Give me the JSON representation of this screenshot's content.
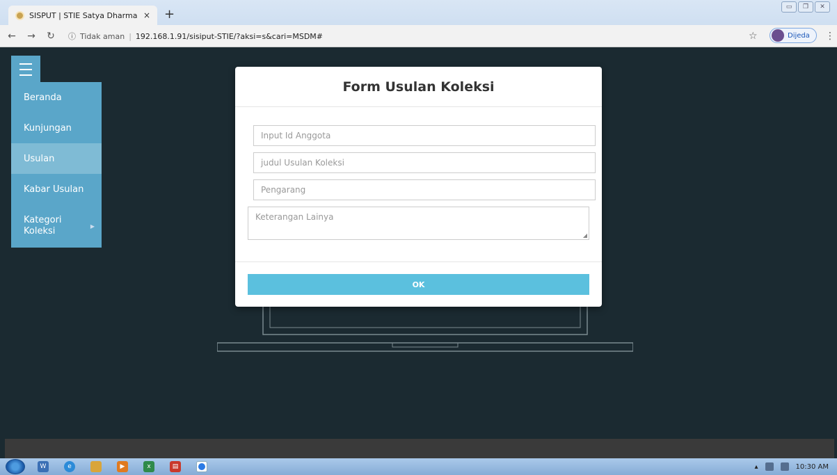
{
  "browser": {
    "tab_title": "SISPUT | STIE Satya Dharma Sing",
    "tab_close": "×",
    "new_tab": "+",
    "address_security": "Tidak aman",
    "address_url": "192.168.1.91/sisiput-STIE/?aksi=s&cari=MSDM#",
    "profile_name": "Dijeda"
  },
  "sidebar": {
    "items": [
      {
        "label": "Beranda"
      },
      {
        "label": "Kunjungan"
      },
      {
        "label": "Usulan"
      },
      {
        "label": "Kabar Usulan"
      },
      {
        "label": "Kategori Koleksi"
      }
    ],
    "active_index": 2
  },
  "modal": {
    "title": "Form Usulan Koleksi",
    "fields": {
      "member_id_placeholder": "Input Id Anggota",
      "title_placeholder": "judul Usulan Koleksi",
      "author_placeholder": "Pengarang",
      "notes_placeholder": "Keterangan Lainya"
    },
    "ok_label": "OK"
  },
  "taskbar": {
    "clock": "10:30 AM"
  },
  "colors": {
    "page_bg": "#1b2a31",
    "sidebar_bg": "#5aa6c9",
    "sidebar_active": "#7fbbd5",
    "ok_button": "#5bc0de"
  }
}
